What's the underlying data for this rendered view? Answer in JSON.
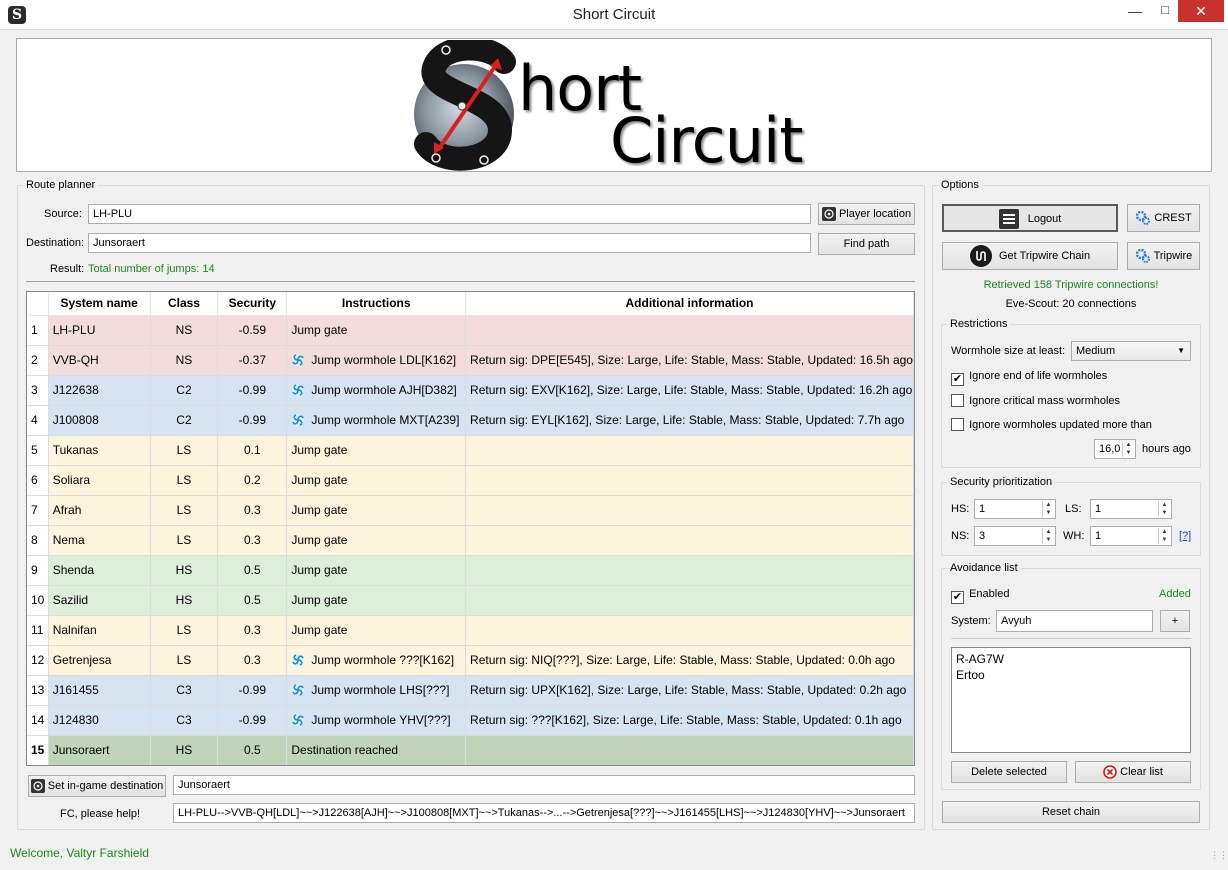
{
  "window": {
    "title": "Short Circuit",
    "icon_letter": "S"
  },
  "banner": {
    "logo_line1": "hort",
    "logo_line2": "Circuit"
  },
  "route_planner": {
    "group_label": "Route planner",
    "source_label": "Source:",
    "source_value": "LH-PLU",
    "player_location_label": "Player location",
    "destination_label": "Destination:",
    "destination_value": "Junsoraert",
    "find_path_label": "Find path",
    "result_label": "Result:",
    "result_value": "Total number of jumps: 14",
    "result_color": "#1a8a1a"
  },
  "table": {
    "headers": [
      "System name",
      "Class",
      "Security",
      "Instructions",
      "Additional information"
    ],
    "rows": [
      {
        "n": "1",
        "name": "LH-PLU",
        "cls": "NS",
        "sec": "-0.59",
        "instr": "Jump gate",
        "wh": false,
        "info": "",
        "bg": "#f3dcdc"
      },
      {
        "n": "2",
        "name": "VVB-QH",
        "cls": "NS",
        "sec": "-0.37",
        "instr": "Jump wormhole LDL[K162]",
        "wh": true,
        "info": "Return sig: DPE[E545], Size: Large, Life: Stable, Mass: Stable, Updated: 16.5h ago",
        "bg": "#f3dcdc"
      },
      {
        "n": "3",
        "name": "J122638",
        "cls": "C2",
        "sec": "-0.99",
        "instr": "Jump wormhole AJH[D382]",
        "wh": true,
        "info": "Return sig: EXV[K162], Size: Large, Life: Stable, Mass: Stable, Updated: 16.2h ago",
        "bg": "#d6e3f1"
      },
      {
        "n": "4",
        "name": "J100808",
        "cls": "C2",
        "sec": "-0.99",
        "instr": "Jump wormhole MXT[A239]",
        "wh": true,
        "info": "Return sig: EYL[K162], Size: Large, Life: Stable, Mass: Stable, Updated: 7.7h ago",
        "bg": "#d6e3f1"
      },
      {
        "n": "5",
        "name": "Tukanas",
        "cls": "LS",
        "sec": "0.1",
        "instr": "Jump gate",
        "wh": false,
        "info": "",
        "bg": "#fcf4dc"
      },
      {
        "n": "6",
        "name": "Soliara",
        "cls": "LS",
        "sec": "0.2",
        "instr": "Jump gate",
        "wh": false,
        "info": "",
        "bg": "#fcf4dc"
      },
      {
        "n": "7",
        "name": "Afrah",
        "cls": "LS",
        "sec": "0.3",
        "instr": "Jump gate",
        "wh": false,
        "info": "",
        "bg": "#fcf4dc"
      },
      {
        "n": "8",
        "name": "Nema",
        "cls": "LS",
        "sec": "0.3",
        "instr": "Jump gate",
        "wh": false,
        "info": "",
        "bg": "#fcf4dc"
      },
      {
        "n": "9",
        "name": "Shenda",
        "cls": "HS",
        "sec": "0.5",
        "instr": "Jump gate",
        "wh": false,
        "info": "",
        "bg": "#dcefd9"
      },
      {
        "n": "10",
        "name": "Sazilid",
        "cls": "HS",
        "sec": "0.5",
        "instr": "Jump gate",
        "wh": false,
        "info": "",
        "bg": "#dcefd9"
      },
      {
        "n": "11",
        "name": "Nalnifan",
        "cls": "LS",
        "sec": "0.3",
        "instr": "Jump gate",
        "wh": false,
        "info": "",
        "bg": "#fcf4dc"
      },
      {
        "n": "12",
        "name": "Getrenjesa",
        "cls": "LS",
        "sec": "0.3",
        "instr": "Jump wormhole ???[K162]",
        "wh": true,
        "info": "Return sig: NIQ[???], Size: Large, Life: Stable, Mass: Stable, Updated: 0.0h ago",
        "bg": "#fcf4dc"
      },
      {
        "n": "13",
        "name": "J161455",
        "cls": "C3",
        "sec": "-0.99",
        "instr": "Jump wormhole LHS[???]",
        "wh": true,
        "info": "Return sig: UPX[K162], Size: Large, Life: Stable, Mass: Stable, Updated: 0.2h ago",
        "bg": "#d6e3f1"
      },
      {
        "n": "14",
        "name": "J124830",
        "cls": "C3",
        "sec": "-0.99",
        "instr": "Jump wormhole YHV[???]",
        "wh": true,
        "info": "Return sig: ???[K162], Size: Large, Life: Stable, Mass: Stable, Updated: 0.1h ago",
        "bg": "#d6e3f1"
      },
      {
        "n": "15",
        "name": "Junsoraert",
        "cls": "HS",
        "sec": "0.5",
        "instr": "Destination reached",
        "wh": false,
        "info": "",
        "bg": "#c0d4b8"
      }
    ]
  },
  "bottom": {
    "set_dest_label": "Set in-game destination",
    "set_dest_value": "Junsoraert",
    "fc_label": "FC, please help!",
    "fc_value": "LH-PLU-->VVB-QH[LDL]~~>J122638[AJH]~~>J100808[MXT]~~>Tukanas-->...-->Getrenjesa[???]~~>J161455[LHS]~~>J124830[YHV]~~>Junsoraert"
  },
  "status": {
    "text": "Welcome, Valtyr Farshield",
    "color": "#1a8a1a"
  },
  "options": {
    "group_label": "Options",
    "logout_label": "Logout",
    "crest_label": "CREST",
    "tripwire_chain_label": "Get Tripwire Chain",
    "tripwire_label": "Tripwire",
    "tripwire_status": "Retrieved 158 Tripwire connections!",
    "evescout_status": "Eve-Scout: 20 connections",
    "reset_chain_label": "Reset chain"
  },
  "restrictions": {
    "group_label": "Restrictions",
    "wh_size_label": "Wormhole size at least:",
    "wh_size_value": "Medium",
    "ignore_eol_label": "Ignore end of life wormholes",
    "ignore_eol_checked": true,
    "ignore_crit_label": "Ignore critical mass wormholes",
    "ignore_crit_checked": false,
    "ignore_updated_label": "Ignore wormholes updated more than",
    "ignore_updated_checked": false,
    "hours_value": "16,0",
    "hours_label": "hours ago"
  },
  "security": {
    "group_label": "Security prioritization",
    "hs_label": "HS:",
    "hs_value": "1",
    "ls_label": "LS:",
    "ls_value": "1",
    "ns_label": "NS:",
    "ns_value": "3",
    "wh_label": "WH:",
    "wh_value": "1",
    "help_label": "[?]"
  },
  "avoidance": {
    "group_label": "Avoidance list",
    "enabled_label": "Enabled",
    "enabled_checked": true,
    "added_label": "Added",
    "system_label": "System:",
    "system_value": "Avyuh",
    "add_label": "+",
    "items": [
      "R-AG7W",
      "Ertoo"
    ],
    "delete_label": "Delete selected",
    "clear_label": "Clear list"
  }
}
